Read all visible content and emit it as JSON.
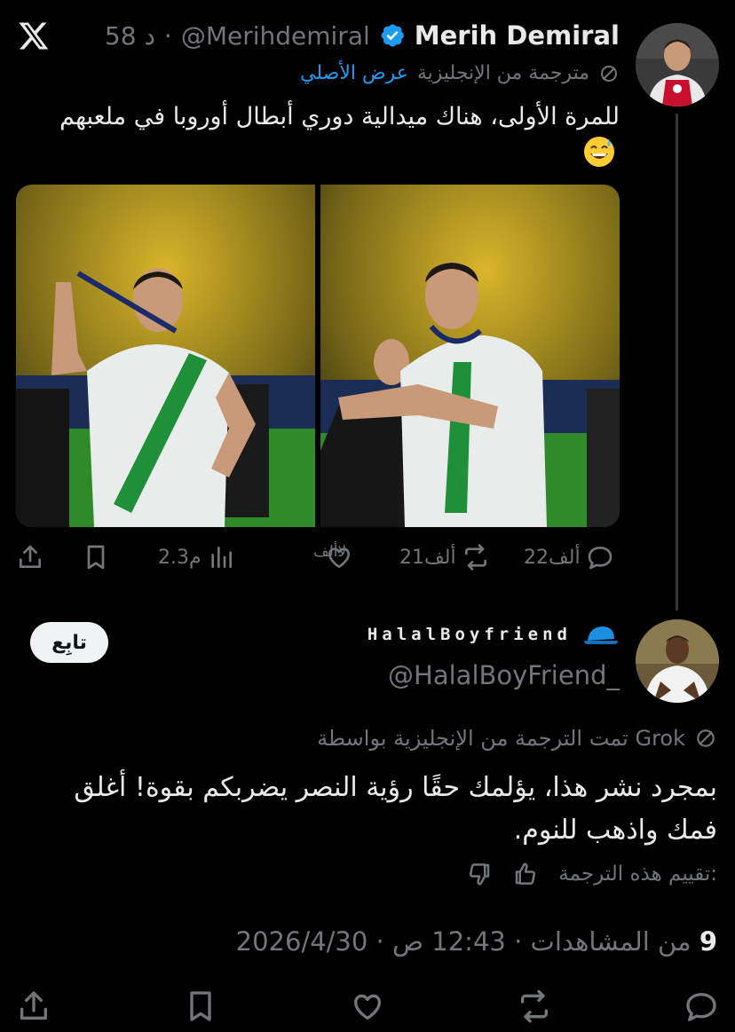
{
  "tweet": {
    "author_name": "Merih Demiral",
    "author_handle": "@Merihdemiral",
    "time_ago": "58 د",
    "translated_from": "مترجمة من الإنجليزية",
    "show_original": "عرض الأصلي",
    "text": "للمرة الأولى، هناك ميدالية دوري أبطال أوروبا في ملعبهم",
    "emoji": "grinning-face-with-sweat",
    "metrics": {
      "replies": "22ألف",
      "reposts": "21ألف",
      "likes": "لاألف",
      "views": "2.3م"
    }
  },
  "reply": {
    "author_name": "HalalBoyfriend",
    "author_handle": "@HalalBoyFriend_",
    "follow_label": "تابِع",
    "grok_translation": "تمت الترجمة من الإنجليزية بواسطة Grok",
    "text": "بمجرد نشر هذا، يؤلمك حقًا رؤية النصر يضربكم بقوة! أغلق فمك واذهب للنوم.",
    "rate_label": "تقييم هذه الترجمة:",
    "date": "2026/4/30",
    "time": "12:43 ص",
    "views_count": "9",
    "views_label": "من المشاهدات"
  },
  "colors": {
    "background": "#000000",
    "text_primary": "#e7e9ea",
    "text_secondary": "#71767b",
    "link": "#1d9bf0",
    "verified": "#1d9bf0",
    "jersey_green": "#1f8f3a",
    "jersey_white": "#e8ecea",
    "cap_blue": "#1d8fe0"
  },
  "icons": [
    "x-logo-icon",
    "verified-badge-icon",
    "translate-icon",
    "reply-icon",
    "repost-icon",
    "like-icon",
    "views-icon",
    "bookmark-icon",
    "share-icon",
    "thumbs-up-icon",
    "thumbs-down-icon",
    "blue-cap-icon"
  ]
}
